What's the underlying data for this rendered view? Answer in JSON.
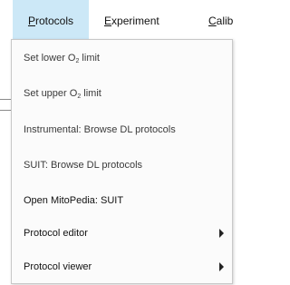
{
  "menubar": {
    "protocols": {
      "mnemonic": "P",
      "rest": "rotocols"
    },
    "experiment": {
      "mnemonic": "E",
      "rest": "xperiment"
    },
    "calib": {
      "mnemonic": "C",
      "rest": "alib"
    }
  },
  "colors": {
    "active_menu_highlight": "#cce8f7",
    "menu_background": "#fbfbfb"
  },
  "protocols_menu": {
    "set_lower": {
      "prefix": "Set lower O",
      "sub": "2",
      "suffix": " limit"
    },
    "set_upper": {
      "prefix": "Set upper O",
      "sub": "2",
      "suffix": " limit"
    },
    "instrumental": "Instrumental: Browse DL protocols",
    "suit": "SUIT: Browse DL protocols",
    "mitopedia": "Open MitoPedia: SUIT",
    "editor": {
      "label": "Protocol editor",
      "submenu_icon": "chevron-right-icon"
    },
    "viewer": {
      "label": "Protocol viewer",
      "submenu_icon": "chevron-right-icon"
    }
  }
}
